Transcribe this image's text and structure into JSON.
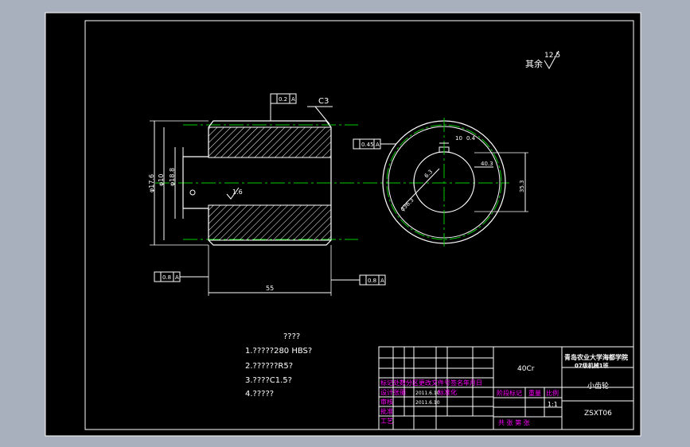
{
  "drawing": {
    "roughness_label": "其余",
    "roughness_value": "12.5",
    "chamfer_label": "C3",
    "tolerance_top": "0.2",
    "tolerance_left_bottom": "0.8",
    "tolerance_right_bottom": "0.8",
    "tolerance_circle": "0.45",
    "dim_outer_diameter": "φ17.6",
    "dim_bore": "φ10",
    "dim_inner_recess": "φ18.8",
    "dim_length": "55",
    "surface_finish_bore": "1.6",
    "keyway_width": "10",
    "keyway_tol": "0.4",
    "keyway_depth_radial": "40.3",
    "keyway_depth_tol": "35.3",
    "dim_circle_diameter": "φ36.3",
    "pitch_circle_label": "6.3"
  },
  "notes": {
    "heading": "????",
    "lines": [
      "1.?????280 HBS?",
      "2.??????R5?",
      "3.????C1.5?",
      "4.?????"
    ]
  },
  "title_block": {
    "school": "青岛农业大学海都学院",
    "dept": "07级机械1班",
    "part_name": "小齿轮",
    "drawing_no": "ZSXT06",
    "material": "40Cr",
    "scale": "1:1",
    "row_labels": [
      "标记处数分区更改文件号签名年月日",
      "设计张丽",
      "审核",
      "工艺",
      "批准"
    ],
    "design_date": "2011.6.10",
    "check_date": "2011.6.10",
    "standard_label": "标准化",
    "stage_label": "阶段标记",
    "weight_label": "重量",
    "scale_label": "比例",
    "sheets_label": "共 张 第 张"
  },
  "colors": {
    "background": "#000000",
    "outline": "#ffffff",
    "center_line": "#00cc00",
    "dimension": "#ffffff",
    "title_text": "#ff00ff",
    "frame_bg": "#a9b0bd"
  }
}
